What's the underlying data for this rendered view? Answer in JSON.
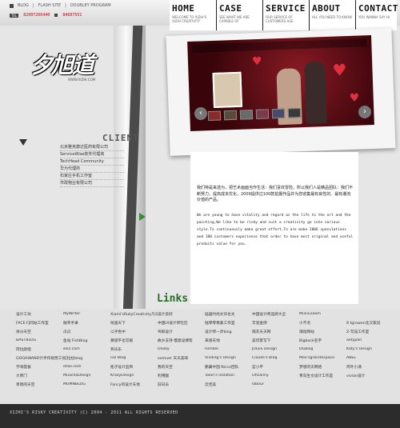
{
  "topbar": {
    "links": [
      "BLOG",
      "FLASH SITE",
      "DOUBLEY PROGRAM"
    ],
    "tel_tag": "TEL",
    "phones": [
      "82007266440",
      "84607551"
    ]
  },
  "nav": [
    {
      "title": "HOME",
      "sub": "WELCOME TO XIZHI'S XIZHI CREATIVITY"
    },
    {
      "title": "CASE",
      "sub": "SEE WHAT WE ARE CAPABLE OF"
    },
    {
      "title": "SERVICE",
      "sub": "OUR SERVICE OF CUSTOMERS AGE"
    },
    {
      "title": "ABOUT",
      "sub": "ALL YOU NEED TO KNOW"
    },
    {
      "title": "CONTACT",
      "sub": "YOU WANNA SAY HI"
    }
  ],
  "logo": {
    "text": "夕旭道",
    "sub": "WWW.XIZHI.COM"
  },
  "client": {
    "heading": "CLIENT",
    "items": [
      "北京雅克康达医药有限公司",
      "ServiceWise软件代理商",
      "TechHead Community",
      "华为代理商",
      "石家庄手机工作室",
      "市政物业有限公司"
    ]
  },
  "about": {
    "cn": "我们特是来选为，把艺术画面当作生活：我们喜欢冒险，所以我们人是精品团队：我们不断努力，提高成本优化，2009提供过100款拍摄作品并为您收集最有良性的、最有潮流价值的产品。",
    "en": "We are young to have vitality and regard as the life to the art and the painting,We like to be risky and suit a creativity go into various style.To continuously make great effort,To are make 2006 speculations and 100 customers experience that order to have most original and useful products value for you."
  },
  "links_heading": "Links",
  "linkgrid": [
    "设计工坊",
    "MyWriter",
    "Xiami'sRukyCreativity凡马编编",
    "设计良好",
    "插画时尚文华也太",
    "中国设计师品牌大全",
    "MusicZoom",
    "",
    "FACE·FJ同站工作室",
    "融禾手录",
    "绘画天下",
    "中国UI设计师社区",
    "陆零零像素工作室",
    "丰宽金牌",
    "小不点",
    "8 tgrowen北汉家说",
    "徐分天空",
    "瓜瓜",
    "以乎色中",
    "驾盼设计",
    "设计师一步blog",
    "隔灰天天网",
    "潮动网站",
    "Z-写设工作室",
    "BASTBLOG",
    "鱼站 FishBlog",
    "黄俊平也写报",
    "故乡支持·慢意设博客",
    "来感天地",
    "美印客写下",
    "Bigbock名字",
    "aetypan",
    "阿拉颜组",
    "ikkz.com",
    "燕乐乐",
    "Dooky",
    "Isimble",
    "JULES Design",
    "DGblog",
    "Katy's Design",
    "GOGHWAND计手作视觉工作室",
    "纪拉拉blog",
    "GO Blog",
    "xxmuer 天天美味",
    "Vivding's Design",
    "Clouds's Blog",
    "Moo'sgranitespace",
    "ABEL",
    "学海提拔",
    "ohwi.com",
    "拓子设计品牌",
    "我的天空",
    "鹏翼中国 Nicco团队",
    "蓝小平",
    "梦想的天网络",
    "阿叶小涌",
    "大师门",
    "MuachaDesign",
    "KrazyDesign",
    "利用酸",
    "Tolon's Isolation",
    "Ohcanny",
    "青岛生文设计工作室",
    "vivian设计",
    "草晓的天空",
    "MUMNBLOG",
    "Fancy的设计天地",
    "旧日员",
    "云佳美",
    "labour",
    "",
    ""
  ],
  "footer": "XIZHI'S RISKY CREATIVITY (C) 2004 - 2011 ALL RIGHTS RESERVED"
}
